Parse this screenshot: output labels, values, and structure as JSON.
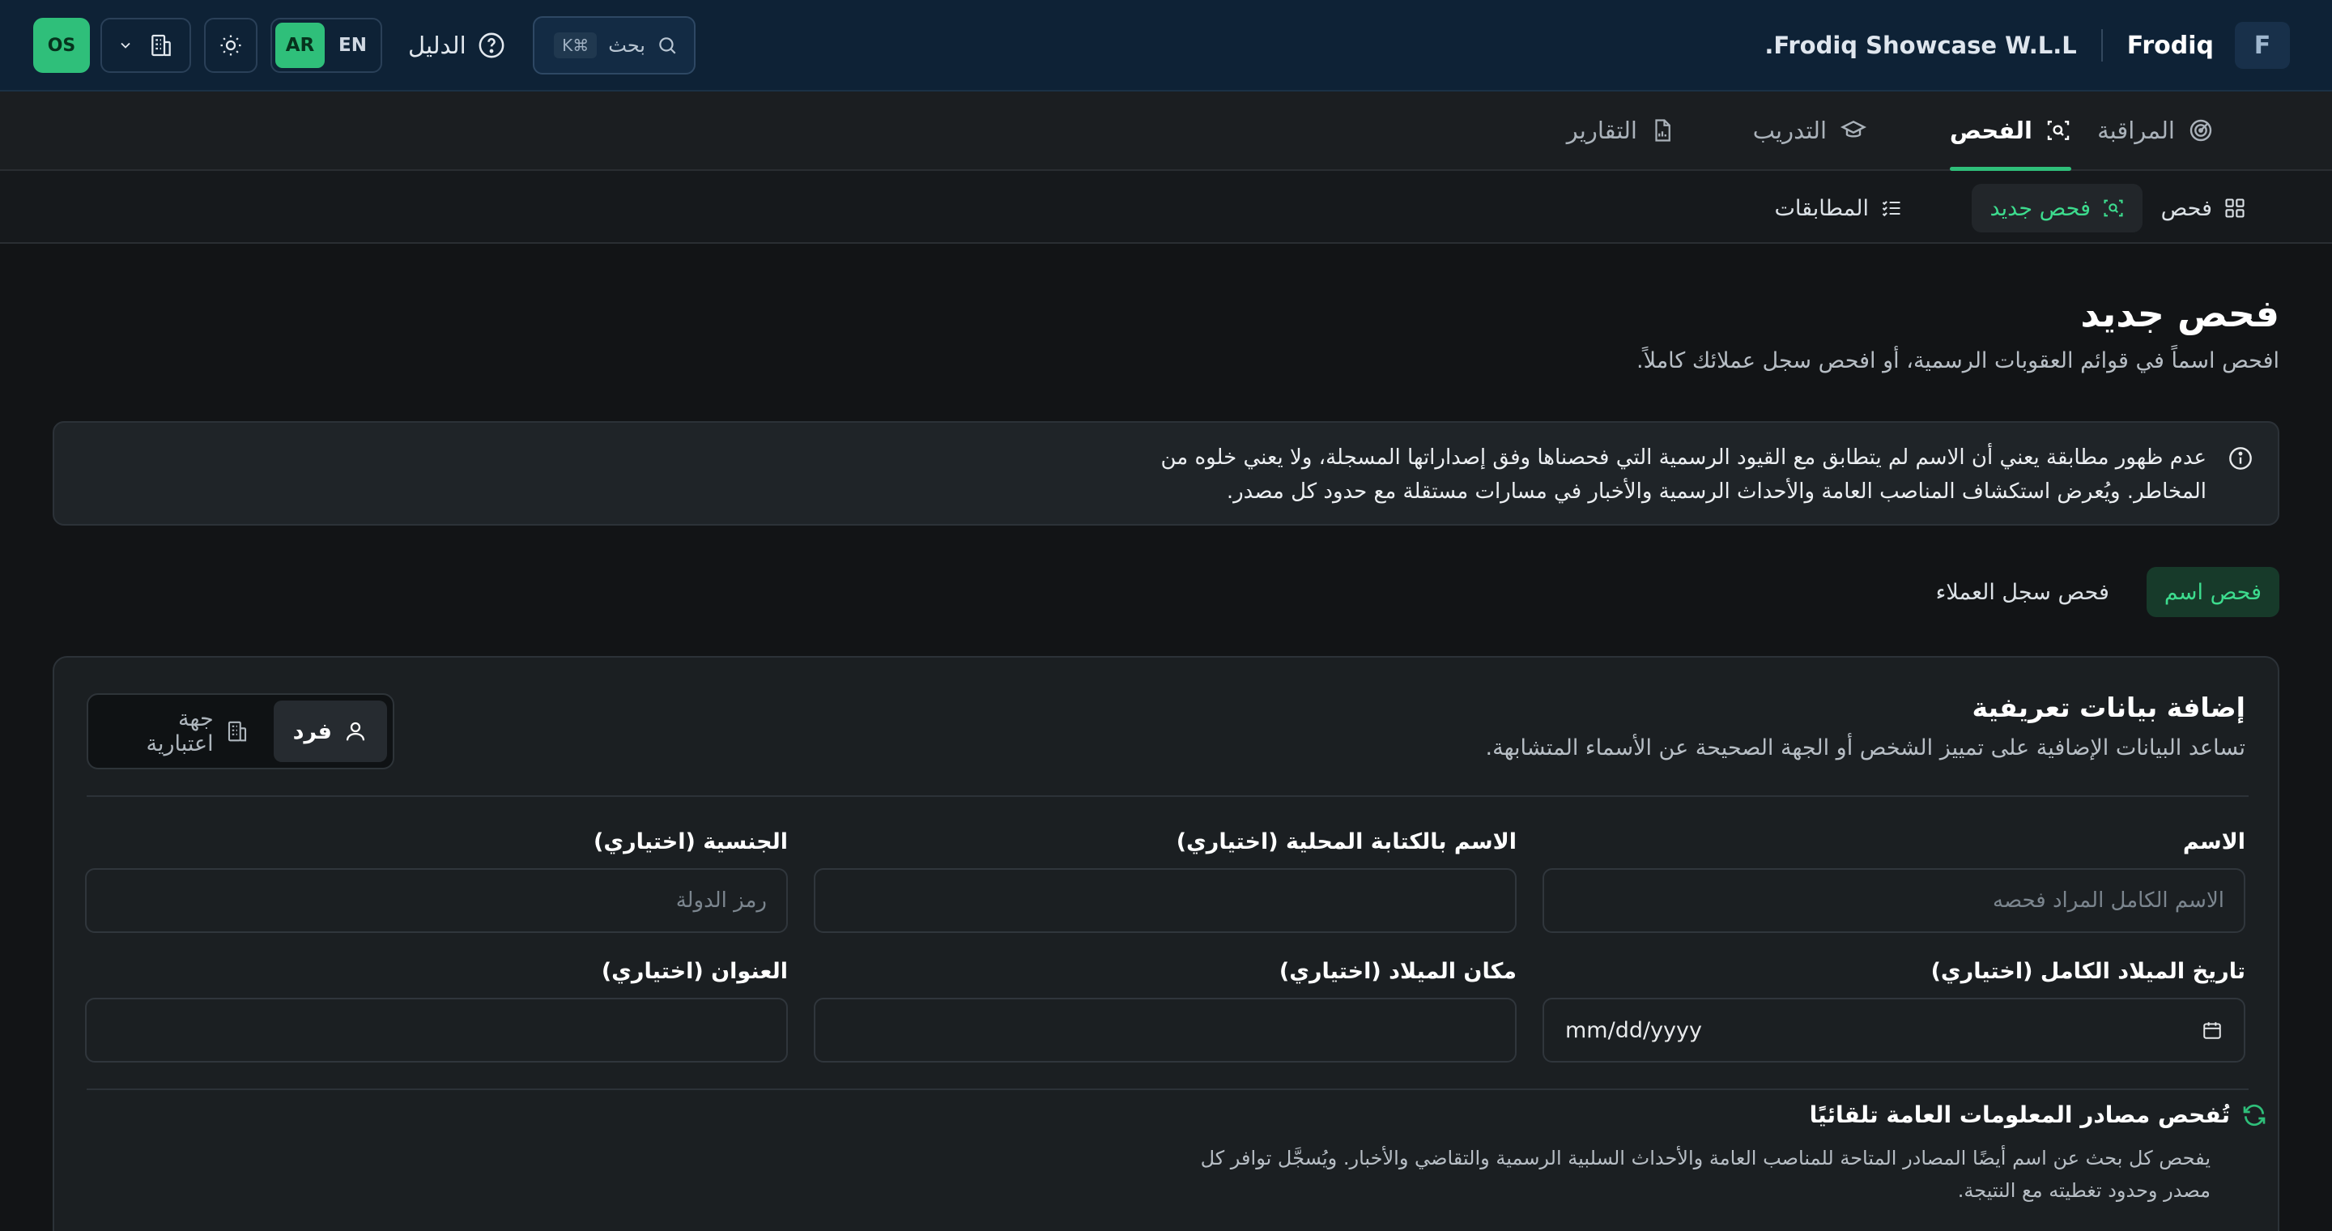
{
  "header": {
    "brand_mark": "F",
    "brand_name": "Frodiq",
    "company": "Frodiq Showcase W.L.L.",
    "search_label": "بحث",
    "search_shortcut": "⌘K",
    "guide_label": "الدليل",
    "lang_active": "AR",
    "lang_other": "EN",
    "user_initials": "OS",
    "accent": "#2fbf7a",
    "icons": [
      "search-icon",
      "help-circle-icon",
      "sun-icon",
      "building-icon",
      "chevron-down-icon"
    ]
  },
  "main_nav": [
    {
      "label": "المراقبة",
      "icon": "radar-icon",
      "active": false
    },
    {
      "label": "الفحص",
      "icon": "scan-icon",
      "active": true
    },
    {
      "label": "التدريب",
      "icon": "graduation-cap-icon",
      "active": false
    },
    {
      "label": "التقارير",
      "icon": "report-file-icon",
      "active": false
    }
  ],
  "sub_nav": [
    {
      "label": "فحص",
      "icon": "grid-icon",
      "active": false
    },
    {
      "label": "فحص جديد",
      "icon": "scan-icon",
      "active": true
    },
    {
      "label": "المطابقات",
      "icon": "list-check-icon",
      "active": false
    }
  ],
  "page": {
    "title": "فحص جديد",
    "subtitle": "افحص اسماً في قوائم العقوبات الرسمية، أو افحص سجل عملائك كاملاً."
  },
  "notice": {
    "text": "عدم ظهور مطابقة يعني أن الاسم لم يتطابق مع القيود الرسمية التي فحصناها وفق إصداراتها المسجلة، ولا يعني خلوه من المخاطر. ويُعرض استكشاف المناصب العامة والأحداث الرسمية والأخبار في مسارات مستقلة مع حدود كل مصدر."
  },
  "mode_tabs": [
    {
      "label": "فحص اسم",
      "active": true
    },
    {
      "label": "فحص سجل العملاء",
      "active": false
    }
  ],
  "form": {
    "title": "إضافة بيانات تعريفية",
    "subtitle": "تساعد البيانات الإضافية على تمييز الشخص أو الجهة الصحيحة عن الأسماء المتشابهة.",
    "entity_types": [
      {
        "label": "فرد",
        "icon": "user-icon",
        "active": true
      },
      {
        "label": "جهة اعتبارية",
        "icon": "building-icon",
        "active": false
      }
    ],
    "fields": {
      "name": {
        "label": "الاسم",
        "placeholder": "الاسم الكامل المراد فحصه",
        "value": ""
      },
      "local_name": {
        "label": "الاسم بالكتابة المحلية (اختياري)",
        "placeholder": "",
        "value": ""
      },
      "nationality": {
        "label": "الجنسية (اختياري)",
        "placeholder": "رمز الدولة",
        "value": ""
      },
      "dob": {
        "label": "تاريخ الميلاد الكامل (اختياري)",
        "value": "mm/dd/yyyy"
      },
      "birthplace": {
        "label": "مكان الميلاد (اختياري)",
        "placeholder": "",
        "value": ""
      },
      "address": {
        "label": "العنوان (اختياري)",
        "placeholder": "",
        "value": ""
      }
    },
    "auto_check": {
      "title": "تُفحص مصادر المعلومات العامة تلقائيًا",
      "description": "يفحص كل بحث عن اسم أيضًا المصادر المتاحة للمناصب العامة والأحداث السلبية الرسمية والتقاضي والأخبار. ويُسجَّل توافر كل مصدر وحدود تغطيته مع النتيجة."
    }
  }
}
